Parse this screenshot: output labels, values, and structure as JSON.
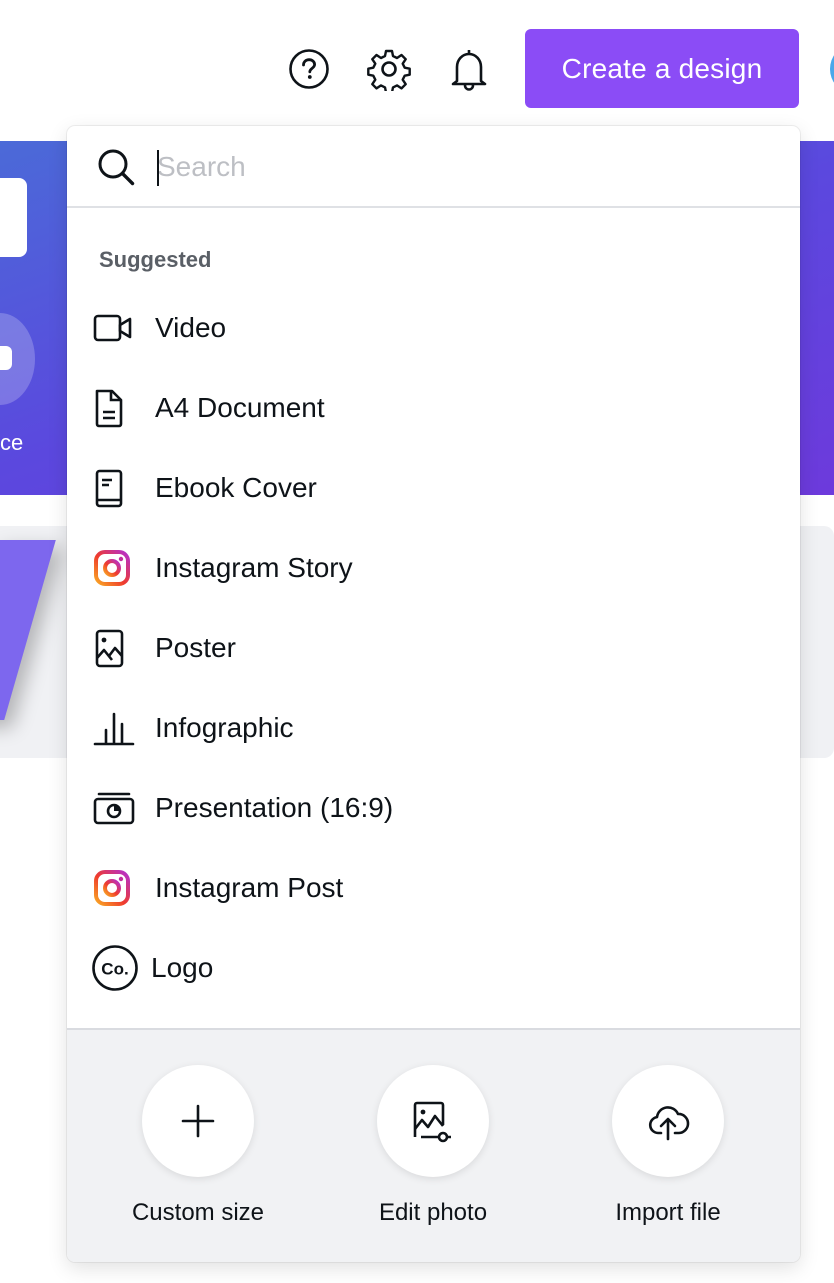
{
  "header": {
    "help_icon": "help-circle-icon",
    "settings_icon": "gear-icon",
    "notifications_icon": "bell-icon",
    "create_button_label": "Create a design",
    "accent_color": "#8b4cf6"
  },
  "background": {
    "banner_partial_label": "ce"
  },
  "dropdown": {
    "search": {
      "placeholder": "Search",
      "value": ""
    },
    "section_label": "Suggested",
    "items": [
      {
        "label": "Video",
        "icon": "video-camera-icon"
      },
      {
        "label": "A4 Document",
        "icon": "document-icon"
      },
      {
        "label": "Ebook Cover",
        "icon": "ebook-icon"
      },
      {
        "label": "Instagram Story",
        "icon": "instagram-icon"
      },
      {
        "label": "Poster",
        "icon": "poster-image-icon"
      },
      {
        "label": "Infographic",
        "icon": "bar-chart-icon"
      },
      {
        "label": "Presentation (16:9)",
        "icon": "presentation-icon"
      },
      {
        "label": "Instagram Post",
        "icon": "instagram-icon"
      },
      {
        "label": "Logo",
        "icon": "logo-co-icon"
      }
    ],
    "actions": [
      {
        "label": "Custom size",
        "icon": "plus-icon"
      },
      {
        "label": "Edit photo",
        "icon": "edit-photo-icon"
      },
      {
        "label": "Import file",
        "icon": "cloud-upload-icon"
      }
    ]
  }
}
